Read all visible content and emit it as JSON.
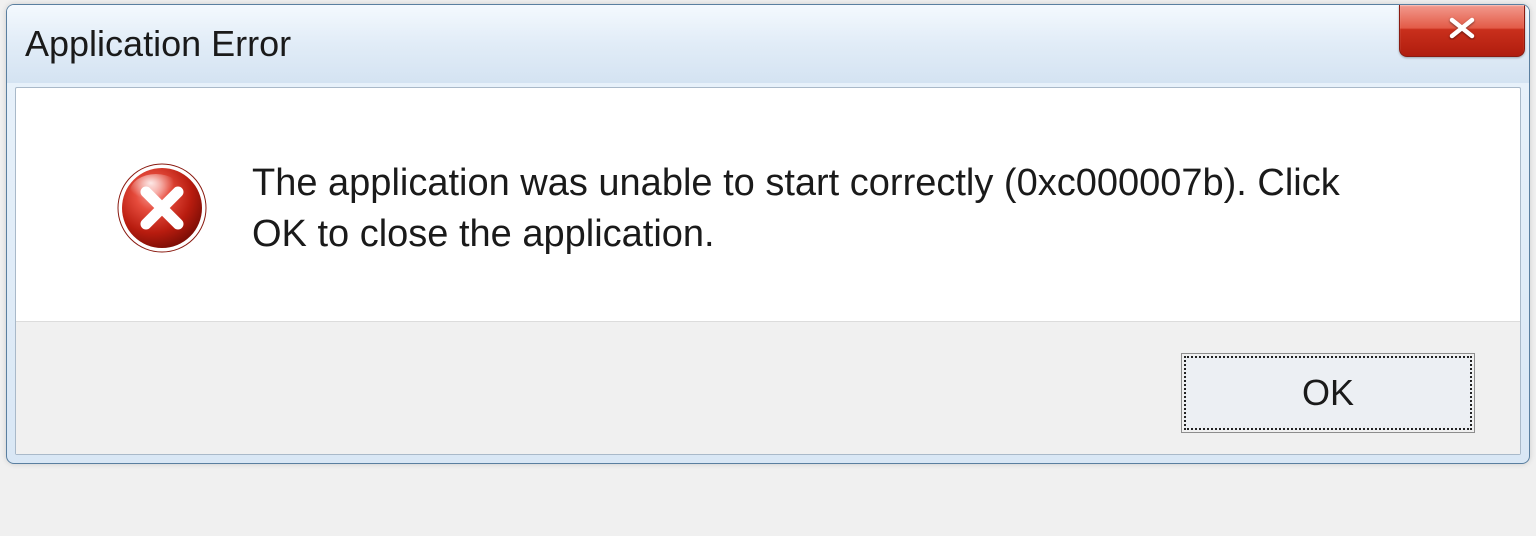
{
  "dialog": {
    "title": "Application Error",
    "message": "The application was unable to start correctly (0xc000007b). Click OK to close the application.",
    "ok_label": "OK",
    "icon": "error-x-icon",
    "close_icon": "close-icon"
  }
}
